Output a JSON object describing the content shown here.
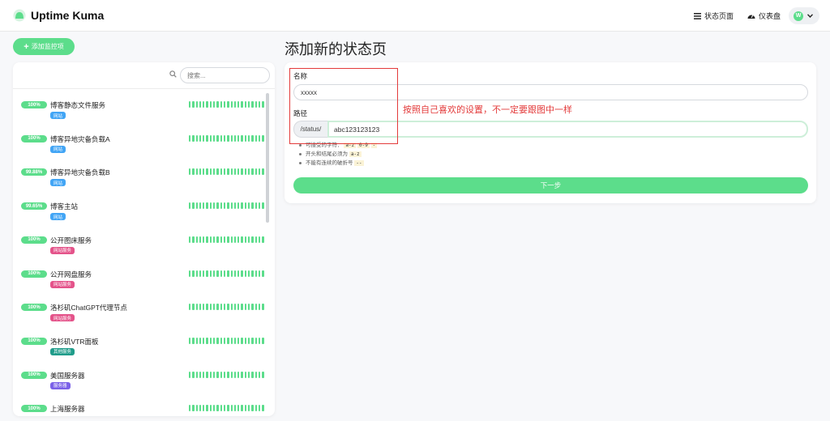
{
  "app": {
    "title": "Uptime Kuma"
  },
  "header": {
    "status_page": "状态页面",
    "dashboard": "仪表盘",
    "avatar_letter": "W"
  },
  "sidebar": {
    "add_button": "添加监控项",
    "search_placeholder": "搜索...",
    "items": [
      {
        "percent": "100%",
        "name": "博客静态文件服务",
        "tag": "网站",
        "tag_color": "#42a5f5"
      },
      {
        "percent": "100%",
        "name": "博客异地灾备负载A",
        "tag": "网站",
        "tag_color": "#42a5f5"
      },
      {
        "percent": "99.88%",
        "name": "博客异地灾备负载B",
        "tag": "网站",
        "tag_color": "#42a5f5"
      },
      {
        "percent": "99.65%",
        "name": "博客主站",
        "tag": "网站",
        "tag_color": "#42a5f5"
      },
      {
        "percent": "100%",
        "name": "公开图床服务",
        "tag": "网站服务",
        "tag_color": "#e4538a"
      },
      {
        "percent": "100%",
        "name": "公开网盘服务",
        "tag": "网站服务",
        "tag_color": "#e4538a"
      },
      {
        "percent": "100%",
        "name": "洛杉矶ChatGPT代理节点",
        "tag": "网站服务",
        "tag_color": "#e4538a"
      },
      {
        "percent": "100%",
        "name": "洛杉矶VTR面板",
        "tag": "其他服务",
        "tag_color": "#1f9c8a"
      },
      {
        "percent": "100%",
        "name": "美国服务器",
        "tag": "服务器",
        "tag_color": "#7b61e8"
      },
      {
        "percent": "100%",
        "name": "上海服务器",
        "tag": "",
        "tag_color": "#7b61e8"
      }
    ]
  },
  "main": {
    "title": "添加新的状态页",
    "name_label": "名称",
    "name_value": "xxxxx",
    "path_label": "路径",
    "path_prefix": "/status/",
    "path_value": "abc123123123",
    "rule1_text": "可接受的字符：",
    "rule1_code1": "a-z",
    "rule1_code2": "0-9",
    "rule1_code3": "-",
    "rule2_text": "开头和结尾必须为",
    "rule2_code": "a-z",
    "rule3_text": "不能有连续的破折号",
    "rule3_code": "--",
    "next_button": "下一步"
  },
  "annotation": {
    "text": "按照自己喜欢的设置，不一定要跟图中一样",
    "color": "#e33b3b"
  },
  "colors": {
    "accent": "#5cdd8b"
  }
}
